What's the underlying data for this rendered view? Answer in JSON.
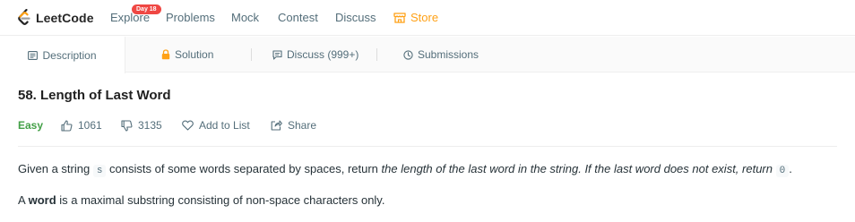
{
  "app": {
    "logo_text": "LeetCode"
  },
  "nav": {
    "items": [
      "Explore",
      "Problems",
      "Mock",
      "Contest",
      "Discuss"
    ],
    "store_label": "Store",
    "badge": "Day 18"
  },
  "tabs": [
    {
      "label": "Description",
      "icon": "document-icon",
      "active": true
    },
    {
      "label": "Solution",
      "icon": "lock-icon",
      "active": false
    },
    {
      "label": "Discuss (999+)",
      "icon": "chat-icon",
      "active": false
    },
    {
      "label": "Submissions",
      "icon": "clock-icon",
      "active": false
    }
  ],
  "problem": {
    "title": "58. Length of Last Word",
    "difficulty": "Easy",
    "likes": "1061",
    "dislikes": "3135",
    "add_to_list": "Add to List",
    "share": "Share",
    "desc1_prefix": "Given a string ",
    "desc1_code": "s",
    "desc1_mid": " consists of some words separated by spaces, return ",
    "desc1_em": "the length of the last word in the string. If the last word does not exist, return ",
    "desc1_code2": "0",
    "desc1_end": ".",
    "desc2_prefix": "A ",
    "desc2_bold": "word",
    "desc2_rest": " is a maximal substring consisting of non-space characters only."
  },
  "colors": {
    "accent": "#ffa116",
    "easy": "#43a047",
    "badge": "#ef4743",
    "text": "#263238",
    "muted": "#546e7a"
  }
}
